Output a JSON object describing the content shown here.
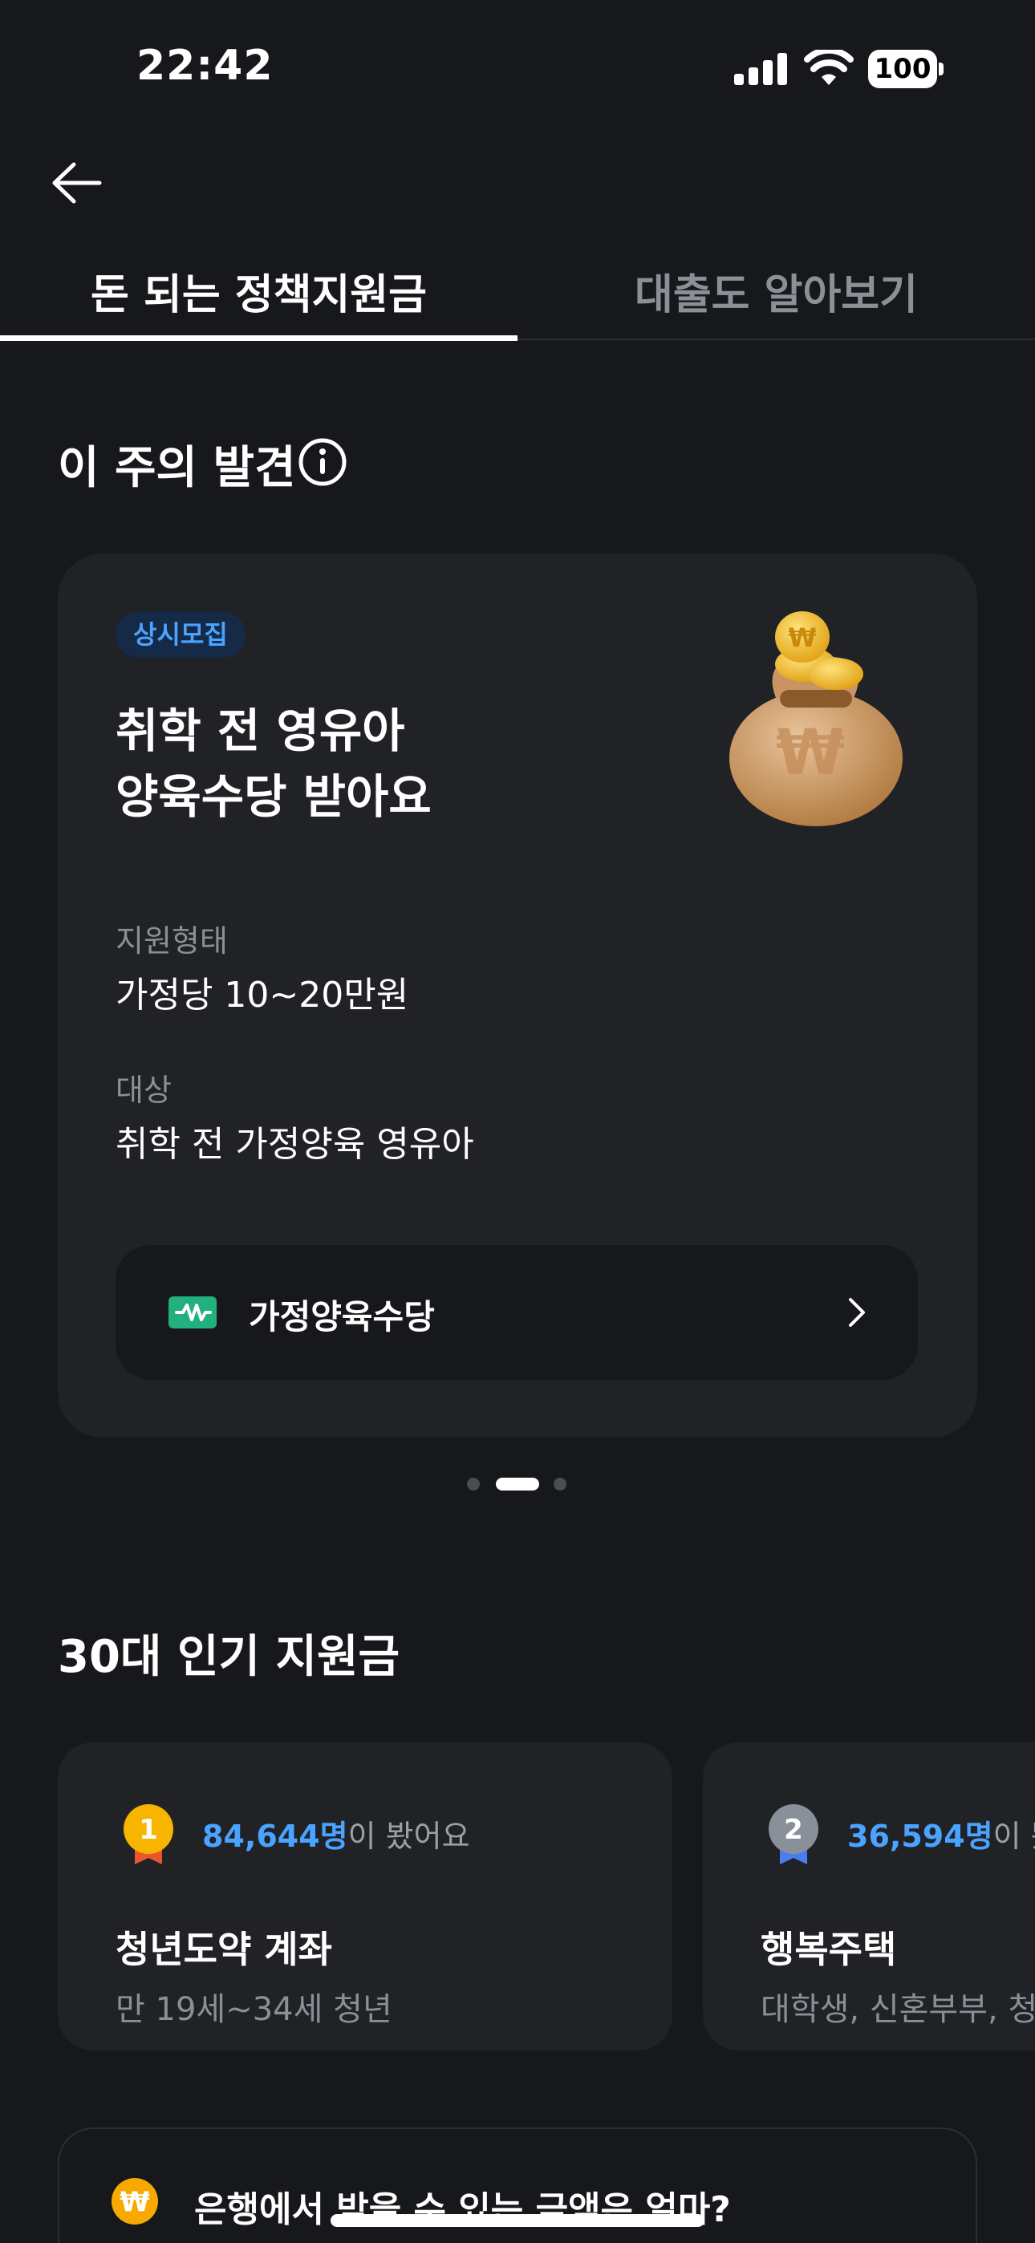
{
  "status_bar": {
    "time": "22:42",
    "battery": "100",
    "icons": [
      "signal-icon",
      "wifi-icon",
      "battery-icon"
    ]
  },
  "nav": {
    "back_icon": "arrow-left-icon"
  },
  "tabs": [
    {
      "label": "돈 되는 정책지원금",
      "active": true
    },
    {
      "label": "대출도 알아보기",
      "active": false
    }
  ],
  "weekly": {
    "title": "이 주의 발견",
    "info_icon": "info-icon",
    "card": {
      "badge": "상시모집",
      "title_line1": "취학 전 영유아",
      "title_line2": "양육수당 받아요",
      "illustration": "money-bag-icon",
      "support_type_label": "지원형태",
      "support_type_value": "가정당 10~20만원",
      "target_label": "대상",
      "target_value": "취학 전 가정양육 영유아",
      "program_name": "가정양육수당",
      "program_icon": "program-logo-icon",
      "chevron_icon": "chevron-right-icon"
    },
    "pager": {
      "count": 3,
      "active_index": 1
    }
  },
  "popular": {
    "title": "30대 인기 지원금",
    "items": [
      {
        "rank": "1",
        "views": "84,644명",
        "views_suffix": "이 봤어요",
        "name": "청년도약 계좌",
        "target": "만 19세~34세 청년",
        "medal_color": "#f7b500",
        "ribbon_color": "#e8562a"
      },
      {
        "rank": "2",
        "views": "36,594명",
        "views_suffix": "이 봤어요",
        "name": "행복주택",
        "target": "대학생, 신혼부부, 청년",
        "medal_color": "#8a909a",
        "ribbon_color": "#4a7ef0"
      }
    ]
  },
  "bottom_banner": {
    "icon": "won-coin-icon",
    "text": "은행에서 받을 수 있는 금액은 얼마?"
  },
  "colors": {
    "background": "#17181c",
    "card": "#202226",
    "accent_blue": "#4aa3ff",
    "muted_text": "#8b8f96"
  }
}
